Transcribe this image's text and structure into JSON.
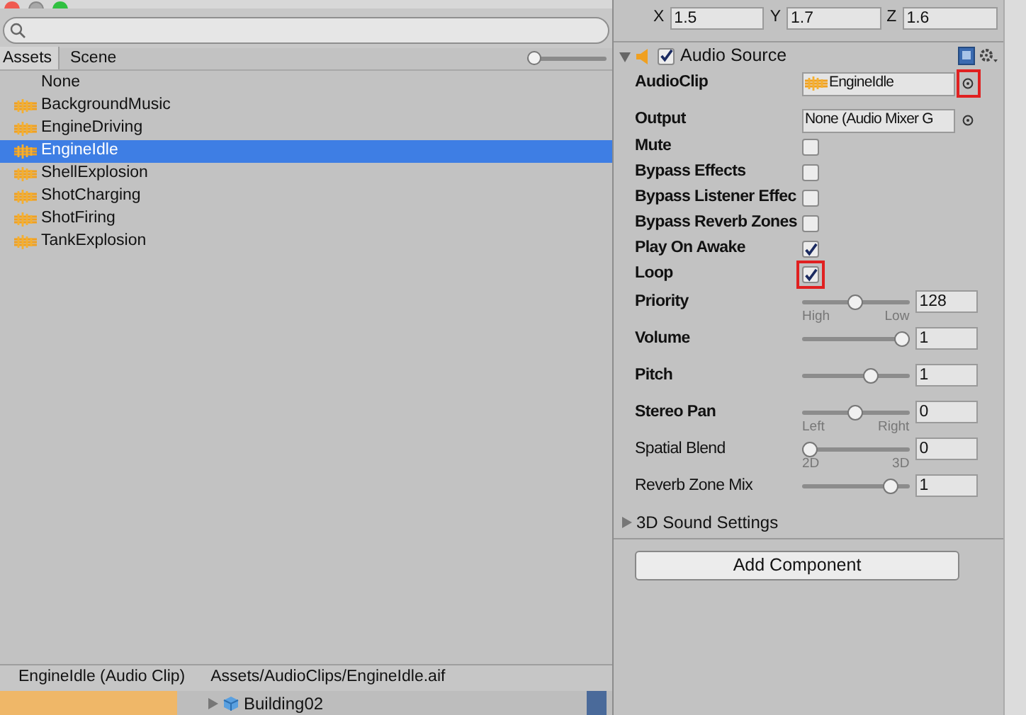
{
  "picker": {
    "tabs": [
      {
        "label": "Assets",
        "selected": true
      },
      {
        "label": "Scene",
        "selected": false
      }
    ],
    "zoom_slider": {
      "level": 0
    },
    "items": [
      {
        "label": "None",
        "icon": false,
        "selected": false
      },
      {
        "label": "BackgroundMusic",
        "icon": true,
        "selected": false
      },
      {
        "label": "EngineDriving",
        "icon": true,
        "selected": false
      },
      {
        "label": "EngineIdle",
        "icon": true,
        "selected": true
      },
      {
        "label": "ShellExplosion",
        "icon": true,
        "selected": false
      },
      {
        "label": "ShotCharging",
        "icon": true,
        "selected": false
      },
      {
        "label": "ShotFiring",
        "icon": true,
        "selected": false
      },
      {
        "label": "TankExplosion",
        "icon": true,
        "selected": false
      }
    ],
    "status_bar": {
      "name": "EngineIdle (Audio Clip)",
      "path": "Assets/AudioClips/EngineIdle.aif"
    }
  },
  "hierarchy": {
    "row": "Building02"
  },
  "inspector": {
    "scale": [
      {
        "axis": "X",
        "value": "1.5"
      },
      {
        "axis": "Y",
        "value": "1.7"
      },
      {
        "axis": "Z",
        "value": "1.6"
      }
    ],
    "component": {
      "title": "Audio Source",
      "enabled": true,
      "expanded": true
    },
    "fields": [
      {
        "kind": "object",
        "label": "AudioClip",
        "bold": true,
        "value": "EngineIdle",
        "icon": true,
        "highlighted": true
      },
      {
        "kind": "object",
        "label": "Output",
        "bold": true,
        "value": "None (Audio Mixer G",
        "icon": false,
        "highlighted": false
      },
      {
        "kind": "checkbox",
        "label": "Mute",
        "bold": true,
        "checked": false,
        "highlighted": false
      },
      {
        "kind": "checkbox",
        "label": "Bypass Effects",
        "bold": true,
        "checked": false,
        "highlighted": false
      },
      {
        "kind": "checkbox",
        "label": "Bypass Listener Effec",
        "bold": true,
        "checked": false,
        "highlighted": false
      },
      {
        "kind": "checkbox",
        "label": "Bypass Reverb Zones",
        "bold": true,
        "checked": false,
        "highlighted": false
      },
      {
        "kind": "checkbox",
        "label": "Play On Awake",
        "bold": true,
        "checked": true,
        "highlighted": false
      },
      {
        "kind": "checkbox",
        "label": "Loop",
        "bold": true,
        "checked": true,
        "highlighted": true
      },
      {
        "kind": "slider",
        "label": "Priority",
        "bold": true,
        "level": 0.5,
        "value": "128",
        "min_label": "High",
        "max_label": "Low"
      },
      {
        "kind": "slider",
        "label": "Volume",
        "bold": true,
        "level": 1,
        "value": "1"
      },
      {
        "kind": "slider",
        "label": "Pitch",
        "bold": true,
        "level": 0.66,
        "value": "1"
      },
      {
        "kind": "slider",
        "label": "Stereo Pan",
        "bold": true,
        "level": 0.5,
        "value": "0",
        "min_label": "Left",
        "max_label": "Right"
      },
      {
        "kind": "slider",
        "label": "Spatial Blend",
        "bold": false,
        "level": 0,
        "value": "0",
        "min_label": "2D",
        "max_label": "3D"
      },
      {
        "kind": "slider",
        "label": "Reverb Zone Mix",
        "bold": false,
        "level": 0.88,
        "value": "1"
      }
    ],
    "section": {
      "label": "3D Sound Settings",
      "expanded": false
    },
    "add_button": "Add Component"
  }
}
